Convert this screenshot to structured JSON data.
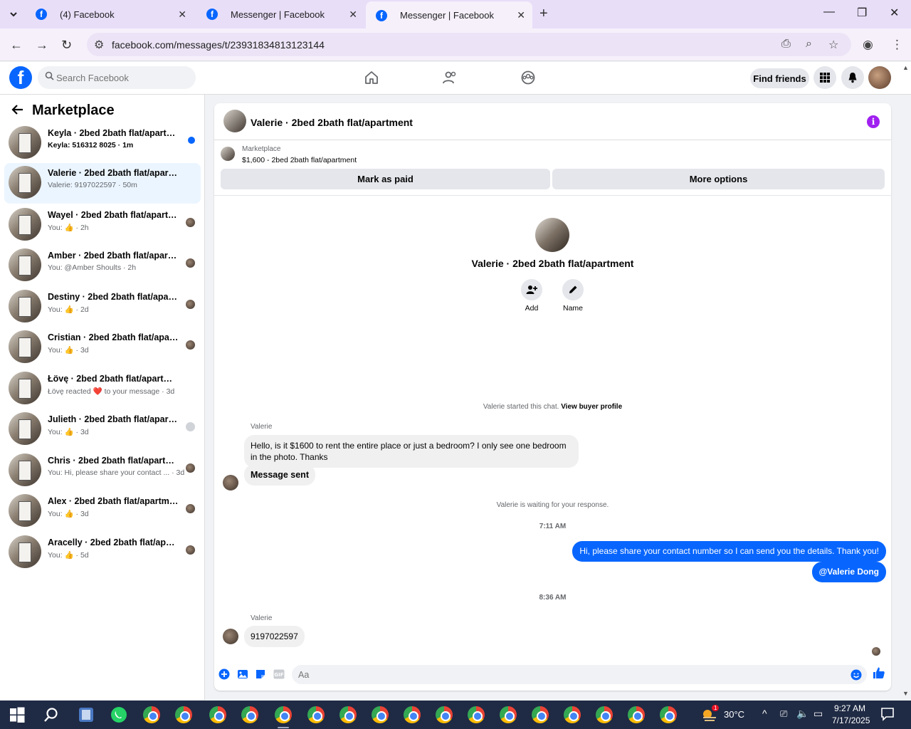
{
  "browser": {
    "tabs": [
      {
        "title": "(4) Facebook"
      },
      {
        "title": "Messenger | Facebook"
      },
      {
        "title": "Messenger | Facebook"
      }
    ],
    "url": "facebook.com/messages/t/23931834813123144"
  },
  "fb_nav": {
    "search_placeholder": "Search Facebook",
    "find_friends": "Find friends"
  },
  "sidebar": {
    "title": "Marketplace",
    "conversations": [
      {
        "title": "Keyla · 2bed 2bath flat/apartment",
        "subtitle": "Keyla: 516312 8025 · 1m",
        "unread": true
      },
      {
        "title": "Valerie · 2bed 2bath flat/apartment",
        "subtitle": "Valerie: 9197022597 · 50m",
        "selected": true
      },
      {
        "title": "Wayel · 2bed 2bath flat/apartment",
        "subtitle": "You: 👍 · 2h"
      },
      {
        "title": "Amber · 2bed 2bath flat/apartment",
        "subtitle": "You: @Amber Shoults · 2h"
      },
      {
        "title": "Destiny · 2bed 2bath flat/apartment",
        "subtitle": "You: 👍 · 2d"
      },
      {
        "title": "Cristian · 2bed 2bath flat/apartment",
        "subtitle": "You: 👍 · 3d"
      },
      {
        "title": "Łövę · 2bed 2bath flat/apartment",
        "subtitle": "Łövę reacted ❤️ to your message · 3d"
      },
      {
        "title": "Julieth · 2bed 2bath flat/apartment",
        "subtitle": "You: 👍 · 3d"
      },
      {
        "title": "Chris · 2bed 2bath flat/apartment",
        "subtitle": "You: Hi, please share your contact ...  · 3d"
      },
      {
        "title": "Alex · 2bed 2bath flat/apartment",
        "subtitle": "You: 👍 · 3d"
      },
      {
        "title": "Aracelly · 2bed 2bath flat/apartment",
        "subtitle": "You: 👍 · 5d"
      }
    ]
  },
  "chat": {
    "header_title": "Valerie · 2bed 2bath flat/apartment",
    "marketplace_label": "Marketplace",
    "listing": "$1,600 - 2bed 2bath flat/apartment",
    "mark_paid": "Mark as paid",
    "more_options": "More options",
    "profile_name": "Valerie · 2bed 2bath flat/apartment",
    "add_label": "Add",
    "name_label": "Name",
    "started_text": "Valerie started this chat.",
    "view_buyer": "View buyer profile",
    "sender1": "Valerie",
    "msg1": "Hello, is it $1600 to rent the entire place or just a bedroom? I only see one bedroom in the photo. Thanks",
    "msg2": "Message sent",
    "waiting": "Valerie is waiting for your response.",
    "time1": "7:11 AM",
    "out1": "Hi, please share your contact number so I can send you the details. Thank you!",
    "out2": "@Valerie Dong",
    "time2": "8:36 AM",
    "sender2": "Valerie",
    "msg3": "9197022597",
    "composer_placeholder": "Aa"
  },
  "taskbar": {
    "temperature": "30°C",
    "time": "9:27 AM",
    "date": "7/17/2025",
    "weather_badge": "1"
  }
}
